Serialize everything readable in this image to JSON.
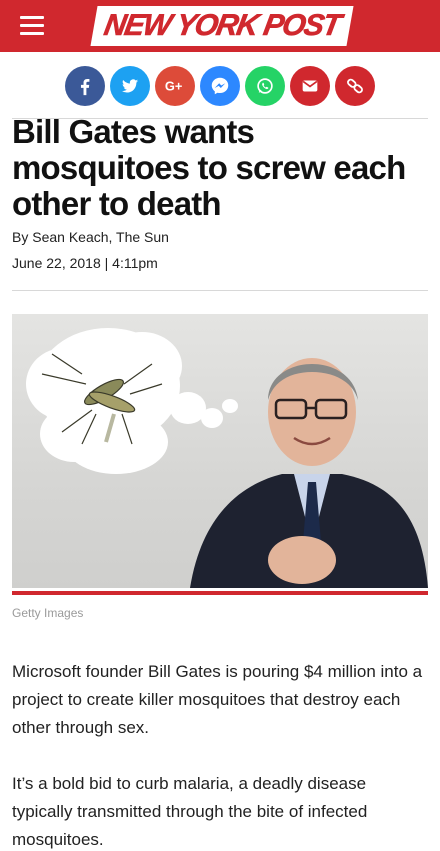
{
  "header": {
    "logo_text": "NEW YORK POST",
    "brand_color": "#d0282e"
  },
  "share_buttons": [
    {
      "name": "facebook-share-button",
      "icon": "facebook-icon",
      "color": "#3b5998"
    },
    {
      "name": "twitter-share-button",
      "icon": "twitter-icon",
      "color": "#1da1f2"
    },
    {
      "name": "google-plus-share-button",
      "icon": "google-plus-icon",
      "color": "#dd4b39"
    },
    {
      "name": "messenger-share-button",
      "icon": "messenger-icon",
      "color": "#2d88ff"
    },
    {
      "name": "whatsapp-share-button",
      "icon": "whatsapp-icon",
      "color": "#25d366"
    },
    {
      "name": "email-share-button",
      "icon": "email-icon",
      "color": "#d0282e"
    },
    {
      "name": "copy-link-button",
      "icon": "link-icon",
      "color": "#d0282e"
    }
  ],
  "article": {
    "headline": "Bill Gates wants mosquitoes to screw each other to death",
    "byline": "By Sean Keach, The Sun",
    "date": "June 22, 2018 | 4:11pm",
    "photo_caption": "Getty Images",
    "paragraphs": [
      "Microsoft founder Bill Gates is pouring $4 million into a project to create killer mosquitoes that destroy each other through sex.",
      "It’s a bold bid to curb malaria, a deadly disease typically transmitted through the bite of infected mosquitoes."
    ]
  }
}
